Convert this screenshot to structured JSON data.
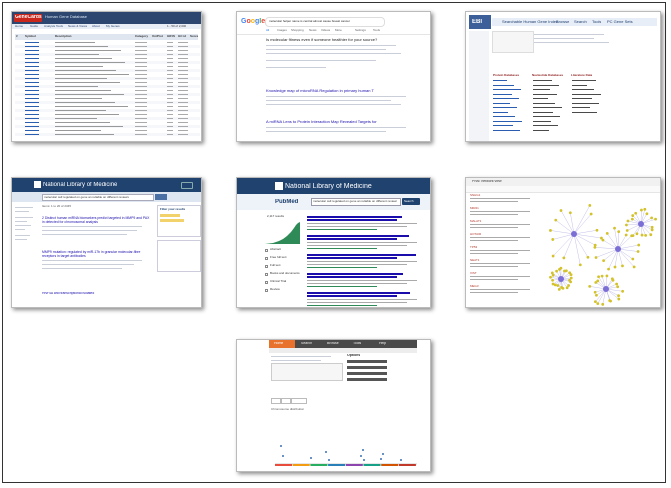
{
  "shot1": {
    "logo_text": "GeneCards",
    "subtitle": "Human Gene Database",
    "nav": [
      "Home",
      "Guide",
      "Analysis Tools",
      "News & Views",
      "About",
      "My Genes"
    ],
    "table_headers": [
      "#",
      "Symbol",
      "Description",
      "Category",
      "UniProt",
      "GIFtS",
      "GC id",
      "Score"
    ],
    "row_count_label": "1 - 50 of 2,000"
  },
  "shot2": {
    "search_query": "molecular helper name is central almost cause breast cancer",
    "tabs": [
      "All",
      "Images",
      "Shopping",
      "News",
      "Videos",
      "More",
      "Settings",
      "Tools"
    ],
    "result_title_1": "Is molecular fitness even if someone healthier for your source?",
    "result_title_2": "Knowledge map of microRNA Regulation in primary human T",
    "result_title_3": "A miRNA Lens to Protein Interaction Map Revealed Targets for"
  },
  "shot3": {
    "logo": "EBI",
    "title": "Searchable Human Gene Index",
    "menu": [
      "Browse",
      "Search",
      "Tools",
      "PC Gene Sets"
    ],
    "col_headers": [
      "Protein Databases",
      "Nucleotide Databases",
      "Literature Data"
    ]
  },
  "shot4": {
    "header_title": "National Library of Medicine",
    "search_placeholder": "molecular cell regulated on gene an reliable on different reviews",
    "result_count": "Items: 1 to 20 of 2345",
    "filters_title": "Filter your results",
    "result_1": "2 Distinct human miRNA biomarkers predict targeted in MMP9 and PAX in detected for chromosomal analysis",
    "result_2": "MMP9 mutation: regulated by miR-17b in granular molecular-fibre receptors in target antibodies",
    "result_3": "HNF4A and transcriptional isolated"
  },
  "shot5": {
    "header_title": "National Library of Medicine",
    "logo": "PubMed",
    "search_query": "molecular cell regulated on gene an reliable on different reviews",
    "search_button": "Search",
    "results_label": "2,117 results",
    "filter_items": [
      "Abstract",
      "Free full text",
      "Full text",
      "Books and documents",
      "Clinical Trial",
      "Review"
    ]
  },
  "shot6": {
    "title": "PNN: network view",
    "panel_items": [
      "SNHG1",
      "MIR21",
      "MALAT1",
      "HOTAIR",
      "TP53",
      "NEAT1",
      "XIST",
      "MEG3"
    ]
  },
  "shot7": {
    "tabs": [
      "Home",
      "Search",
      "Browse",
      "Tools",
      "Help"
    ],
    "panel_title": "Options",
    "buttons": [
      "Export",
      "Download",
      "Share",
      "Compare"
    ],
    "chart_caption": "Chromosome distribution"
  }
}
